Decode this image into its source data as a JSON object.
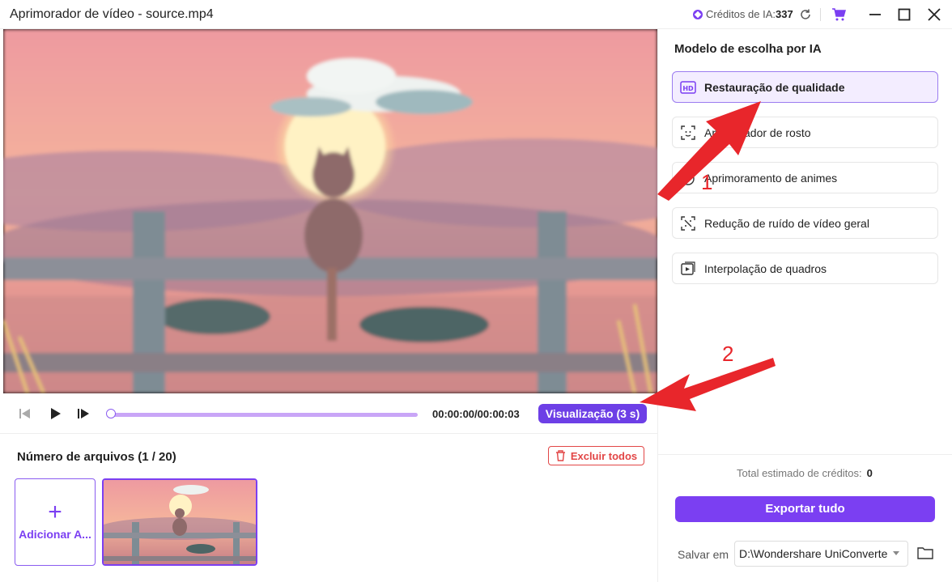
{
  "window": {
    "title": "Aprimorador de vídeo - source.mp4",
    "credits_label": "Créditos de IA:",
    "credits_value": "337"
  },
  "player": {
    "time": "00:00:00/00:00:03",
    "preview_label": "Visualização (3 s)",
    "progress": 0
  },
  "files": {
    "heading": "Número de arquivos (1 / 20)",
    "delete_all_label": "Excluir todos",
    "add_label": "Adicionar A..."
  },
  "panel": {
    "title": "Modelo de escolha por IA",
    "models": [
      {
        "label": "Restauração de qualidade",
        "icon": "hd-icon",
        "active": true
      },
      {
        "label": "Aprimorador de rosto",
        "icon": "face-scan-icon",
        "active": false
      },
      {
        "label": "Aprimoramento de animes",
        "icon": "anime-icon",
        "active": false
      },
      {
        "label": "Redução de ruído de vídeo geral",
        "icon": "noise-reduction-icon",
        "active": false
      },
      {
        "label": "Interpolação de quadros",
        "icon": "frame-interpolation-icon",
        "active": false
      }
    ],
    "total_label": "Total estimado de créditos:",
    "total_value": "0",
    "export_label": "Exportar tudo",
    "save_label": "Salvar em",
    "save_path": "D:\\Wondershare UniConverte"
  },
  "annotations": {
    "label_1": "1",
    "label_2": "2",
    "color": "#e8262b"
  },
  "colors": {
    "accent": "#7b3ff2",
    "danger": "#e24646"
  }
}
